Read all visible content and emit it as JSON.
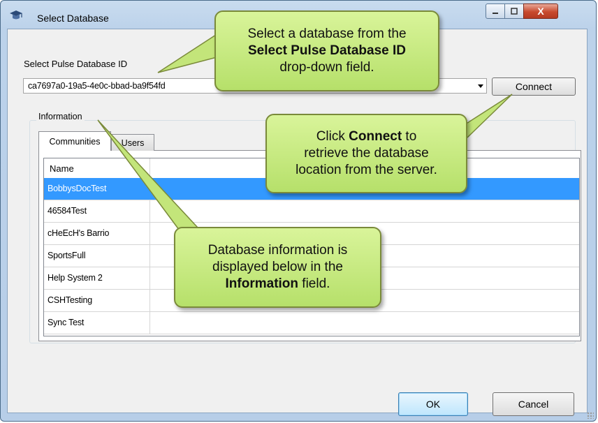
{
  "window": {
    "title": "Select Database",
    "controls": [
      "minimize",
      "maximize",
      "close"
    ],
    "close_glyph": "X"
  },
  "form": {
    "db_label": "Select Pulse Database ID",
    "db_value": "ca7697a0-19a5-4e0c-bbad-ba9f54fd",
    "connect_label": "Connect",
    "group_label": "Information",
    "tabs": [
      {
        "label": "Communities",
        "active": true
      },
      {
        "label": "Users",
        "active": false
      }
    ],
    "list_header": "Name",
    "rows": [
      {
        "name": "BobbysDocTest",
        "selected": true
      },
      {
        "name": "46584Test",
        "selected": false
      },
      {
        "name": "cHeEcH's Barrio",
        "selected": false
      },
      {
        "name": "SportsFull",
        "selected": false
      },
      {
        "name": "Help System 2",
        "selected": false
      },
      {
        "name": "CSHTesting",
        "selected": false
      },
      {
        "name": "Sync Test",
        "selected": false
      }
    ],
    "ok_label": "OK",
    "cancel_label": "Cancel"
  },
  "callouts": {
    "c1": {
      "line1": "Select a database from the",
      "bold": "Select Pulse Database ID",
      "line3": "drop-down field."
    },
    "c2": {
      "pre": "Click ",
      "bold": "Connect",
      "post": " to",
      "line2": "retrieve the database",
      "line3": "location from the server."
    },
    "c3": {
      "line1": "Database information is",
      "line2": "displayed below in the",
      "bold": "Information",
      "post": " field."
    }
  },
  "colors": {
    "callout_fill": "#c6ea7e",
    "selection": "#3399ff",
    "close_button": "#c84a2e"
  }
}
